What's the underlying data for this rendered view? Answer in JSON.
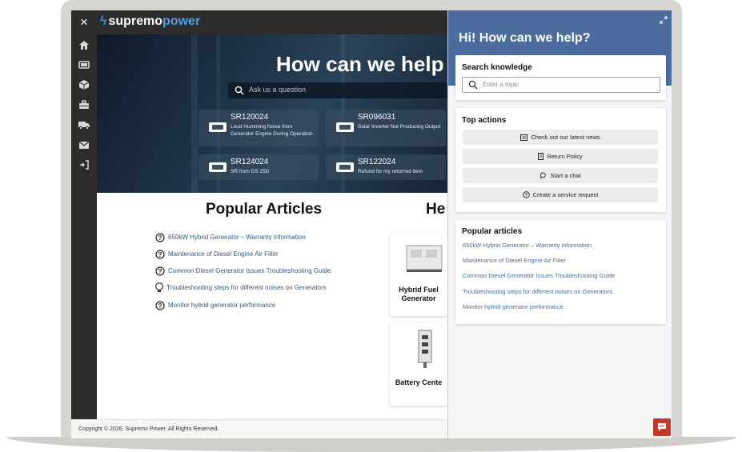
{
  "app": {
    "brand_name": "supremo",
    "brand_accent": "power",
    "accent_color": "#4b6c9c",
    "close_icon": "×"
  },
  "nav": {
    "items": [
      "home-icon",
      "screen-icon",
      "box-icon",
      "toolbox-icon",
      "truck-icon",
      "mail-icon",
      "sign-in-icon"
    ]
  },
  "hero": {
    "title": "How can we help",
    "search_placeholder": "Ask us a question",
    "tickets": [
      {
        "id": "SR120024",
        "description": "Loud Humming Noise from Generator Engine During Operation"
      },
      {
        "id": "SR096031",
        "description": "Solar Inverter Not Producing Output"
      },
      {
        "id": "SR124024",
        "description": "SR from DS 25D"
      },
      {
        "id": "SR122024",
        "description": "Refund for my returned item"
      }
    ]
  },
  "popular": {
    "title": "Popular Articles",
    "articles": [
      {
        "label": "650kW Hybrid Generator – Warranty Information",
        "icon": "question-circle-icon"
      },
      {
        "label": "Maintenance of Diesel Engine Air Filter",
        "icon": "question-circle-icon"
      },
      {
        "label": "Common Diesel Generator Issues Troubleshooting Guide",
        "icon": "question-circle-icon"
      },
      {
        "label": "Troubleshooting steps for different noises on Generators",
        "icon": "lightbulb-icon"
      },
      {
        "label": "Monitor hybrid generator performance",
        "icon": "question-circle-icon"
      }
    ]
  },
  "products": {
    "title": "He",
    "items": [
      {
        "name": "Hybrid Fuel Generator"
      },
      {
        "name": "Battery Cente"
      }
    ]
  },
  "footer": {
    "copyright": "Copyright © 2026, Supremo Power. All Rights Reserved."
  },
  "panel": {
    "title": "Hi! How can we help?",
    "search": {
      "heading": "Search knowledge",
      "placeholder": "Enter a topic"
    },
    "top_actions": {
      "heading": "Top actions",
      "items": [
        {
          "label": "Check out our latest news",
          "icon": "news-icon"
        },
        {
          "label": "Return Policy",
          "icon": "document-icon"
        },
        {
          "label": "Start a chat",
          "icon": "chat-icon"
        },
        {
          "label": "Create a service request",
          "icon": "question-circle-icon"
        }
      ]
    },
    "popular": {
      "heading": "Popular articles",
      "items": [
        "650kW Hybrid Generator – Warranty Information",
        "Maintenance of Diesel Engine Air Filter",
        "Common Diesel Generator Issues Troubleshooting Guide",
        "Troubleshooting steps for different noises on Generators",
        "Monitor hybrid generator performance"
      ]
    }
  }
}
